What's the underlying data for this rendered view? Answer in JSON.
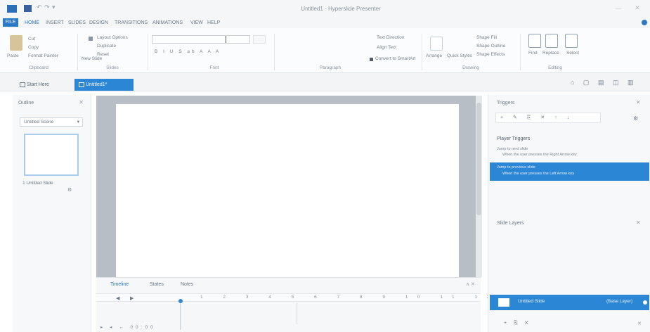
{
  "window": {
    "title": "Untitled1 - Hyperslide Presenter",
    "minimize": "—",
    "close": "✕"
  },
  "quick_access": {
    "undo": "↶",
    "redo": "↷",
    "more": "▾"
  },
  "ribbon": {
    "tabs": [
      {
        "label": "FILE"
      },
      {
        "label": "HOME"
      },
      {
        "label": "INSERT"
      },
      {
        "label": "SLIDES"
      },
      {
        "label": "DESIGN"
      },
      {
        "label": "TRANSITIONS"
      },
      {
        "label": "ANIMATIONS"
      },
      {
        "label": "VIEW"
      },
      {
        "label": "HELP"
      }
    ],
    "groups": {
      "clipboard": {
        "label": "Clipboard",
        "paste": "Paste",
        "cut": "Cut",
        "copy": "Copy",
        "format_painter": "Format Painter"
      },
      "slides": {
        "label": "Slides",
        "new_slide": "New Slide",
        "layout": "Layout Options",
        "duplicate": "Duplicate",
        "reset": "Reset"
      },
      "font": {
        "label": "Font",
        "font_name": "",
        "font_size": "",
        "formatting_row": "B I U S ab A A  A"
      },
      "paragraph": {
        "label": "Paragraph",
        "text_direction": "Text Direction",
        "align_text": "Align Text",
        "smartart": "Convert to SmartArt"
      },
      "drawing": {
        "label": "Drawing",
        "arrange": "Arrange",
        "quick_styles": "Quick Styles",
        "shape_fill": "Shape Fill",
        "shape_outline": "Shape Outline",
        "shape_effects": "Shape Effects"
      },
      "editing": {
        "label": "Editing",
        "find": "Find",
        "replace": "Replace",
        "select": "Select"
      }
    }
  },
  "doc_tabs": [
    {
      "label": "Start Here"
    },
    {
      "label": "Untitled1*"
    }
  ],
  "view_icons": "⌂ ▢ ▤ ◫ ▥",
  "outline": {
    "title": "Outline",
    "close": "✕",
    "scene_select": "Untitled Scene",
    "slide_label": "1  Untitled Slide",
    "marker": "⚙"
  },
  "timeline": {
    "tabs": [
      "Timeline",
      "States",
      "Notes"
    ],
    "close": "∧ ✕",
    "controls_left": "◀",
    "controls_right": "▶",
    "ticks": "1 2 3 4 5 6 7 8 9 10 11 12 13",
    "bottom_controls": "▸ ◂ ↔ 00:00"
  },
  "triggers": {
    "title": "Triggers",
    "close": "✕",
    "toolbar": "+ ✎ ⎘ ✕ ↑ ↓",
    "toolbar_right": "⚙",
    "section": "Player Triggers",
    "item1_l1": "Jump to next slide",
    "item1_l2": "When the user presses the Right Arrow key",
    "selected_l1": "Jump to previous slide",
    "selected_l2": "When the user presses the Left Arrow key",
    "layers_title": "Slide Layers",
    "layers_close": "✕",
    "layer_name": "Untitled Slide",
    "layer_state": "(Base Layer)",
    "bottom_tools": "+ ⎘ ✕",
    "bottom_right": "✕"
  }
}
